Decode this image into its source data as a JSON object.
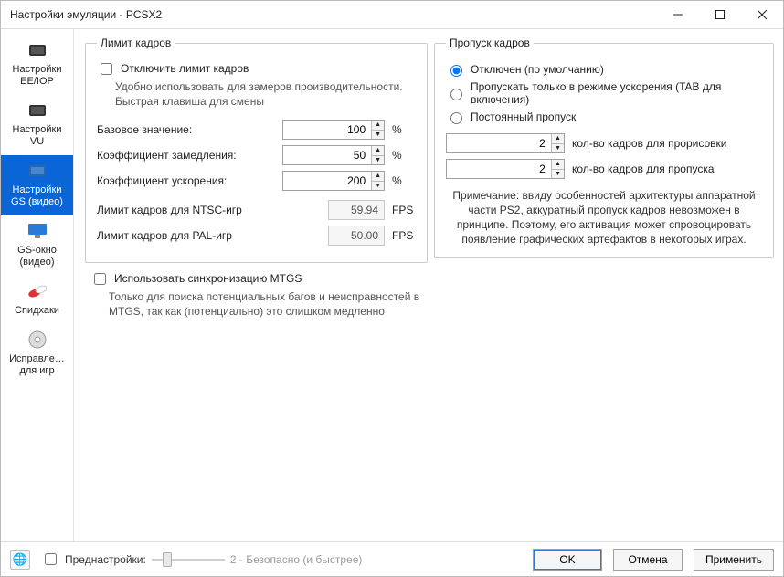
{
  "window": {
    "title": "Настройки эмуляции - PCSX2"
  },
  "sidebar": {
    "items": [
      {
        "l1": "Настройки",
        "l2": "EE/IOP"
      },
      {
        "l1": "Настройки",
        "l2": "VU"
      },
      {
        "l1": "Настройки",
        "l2": "GS (видео)"
      },
      {
        "l1": "GS-окно",
        "l2": "(видео)"
      },
      {
        "l1": "Спидхаки",
        "l2": ""
      },
      {
        "l1": "Исправле…",
        "l2": "для игр"
      }
    ]
  },
  "frameLimit": {
    "legend": "Лимит кадров",
    "disable": {
      "label": "Отключить лимит кадров",
      "hint": "Удобно использовать для замеров производительности. Быстрая клавиша для смены"
    },
    "base": {
      "label": "Базовое значение:",
      "value": "100",
      "unit": "%"
    },
    "slow": {
      "label": "Коэффициент замедления:",
      "value": "50",
      "unit": "%"
    },
    "turbo": {
      "label": "Коэффициент ускорения:",
      "value": "200",
      "unit": "%"
    },
    "ntsc": {
      "label": "Лимит кадров для NTSC-игр",
      "value": "59.94",
      "unit": "FPS"
    },
    "pal": {
      "label": "Лимит кадров для PAL-игр",
      "value": "50.00",
      "unit": "FPS"
    }
  },
  "mtgs": {
    "label": "Использовать синхронизацию MTGS",
    "hint": "Только для поиска потенциальных багов и неисправностей в MTGS, так как (потенциально) это слишком медленно"
  },
  "frameSkip": {
    "legend": "Пропуск кадров",
    "opt1": "Отключен (по умолчанию)",
    "opt2": "Пропускать только в режиме ускорения (TAB для включения)",
    "opt3": "Постоянный пропуск",
    "draw": {
      "value": "2",
      "label": "кол-во кадров для прорисовки"
    },
    "skip": {
      "value": "2",
      "label": "кол-во кадров для пропуска"
    },
    "note": "Примечание: ввиду особенностей архитектуры аппаратной части PS2, аккуратный пропуск кадров невозможен в принципе. Поэтому, его активация может спровоцировать появление графических артефактов в некоторых играх."
  },
  "footer": {
    "preset": "Преднастройки:",
    "presetDesc": "2 - Безопасно (и быстрее)",
    "ok": "OK",
    "cancel": "Отмена",
    "apply": "Применить"
  }
}
